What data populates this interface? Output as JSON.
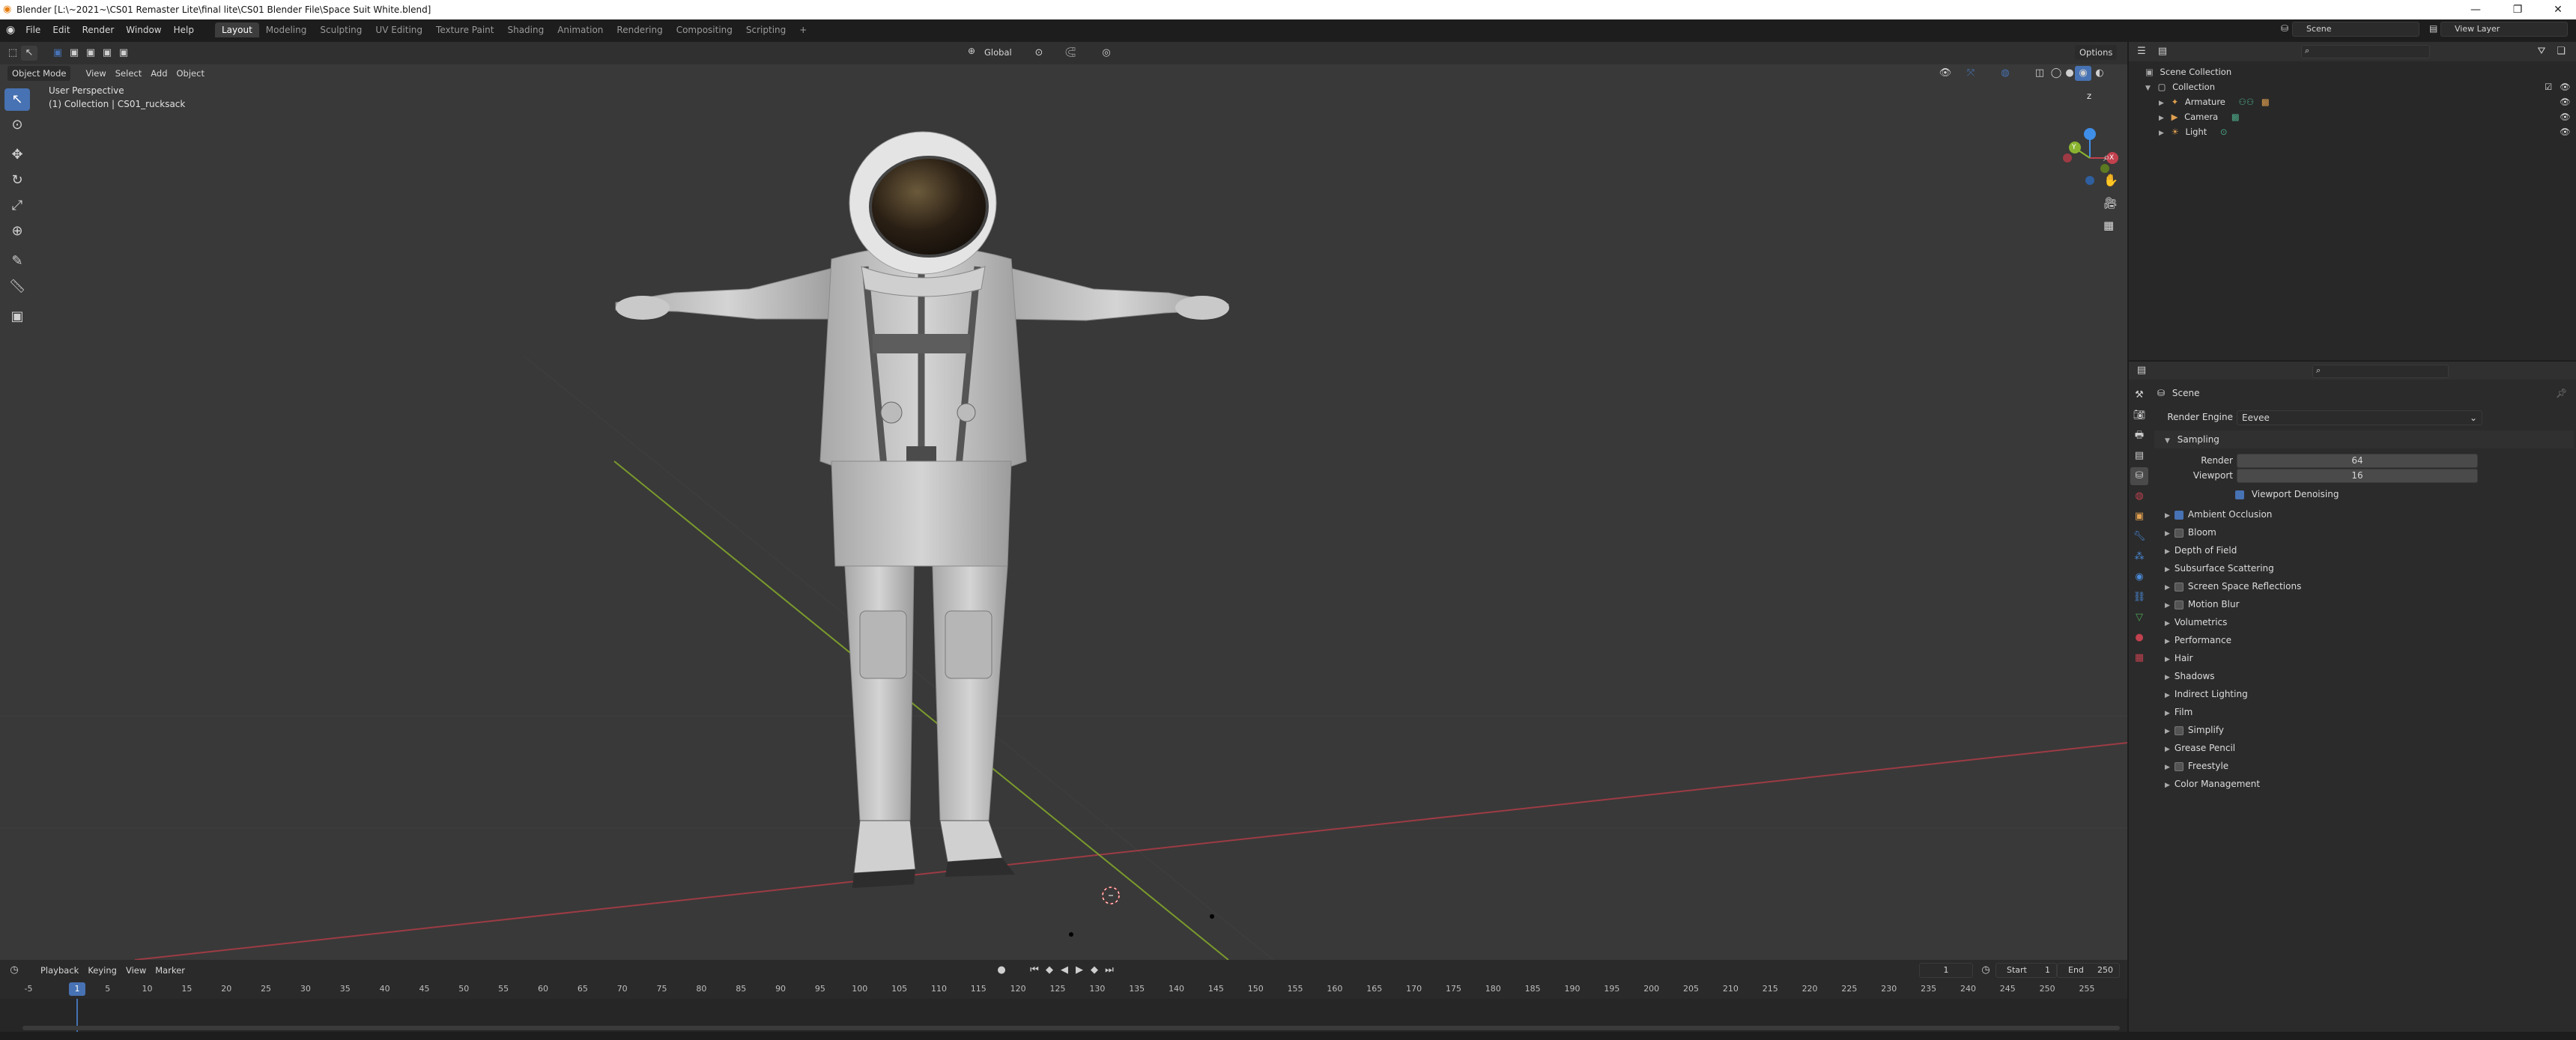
{
  "window": {
    "title": "Blender [L:\\~2021~\\CS01 Remaster Lite\\final lite\\CS01 Blender File\\Space Suit White.blend]",
    "minimize": "—",
    "maximize": "❐",
    "close": "✕"
  },
  "menubar": {
    "items": [
      "File",
      "Edit",
      "Render",
      "Window",
      "Help"
    ],
    "workspaces": [
      "Layout",
      "Modeling",
      "Sculpting",
      "UV Editing",
      "Texture Paint",
      "Shading",
      "Animation",
      "Rendering",
      "Compositing",
      "Scripting"
    ],
    "active_workspace": "Layout",
    "add_tab": "+",
    "scene": "Scene",
    "view_layer": "View Layer"
  },
  "viewport": {
    "mode": "Object Mode",
    "menus": [
      "View",
      "Select",
      "Add",
      "Object"
    ],
    "transform_orientation": "Global",
    "options": "Options",
    "perspective_label": "User Perspective",
    "collection_label": "(1) Collection | CS01_rucksack",
    "gizmo": {
      "x": "X",
      "y": "Y",
      "z": "Z"
    }
  },
  "tools": [
    "cursor",
    "select-box",
    "move",
    "rotate",
    "scale",
    "transform",
    "annotate",
    "measure",
    "add-cube"
  ],
  "timeline": {
    "menus": [
      "Playback",
      "Keying",
      "View",
      "Marker"
    ],
    "current_frame": "1",
    "start_label": "Start",
    "start": "1",
    "end_label": "End",
    "end": "250",
    "playhead_frame": "1",
    "ticks": [
      "-5",
      "1",
      "5",
      "10",
      "15",
      "20",
      "25",
      "30",
      "35",
      "40",
      "45",
      "50",
      "55",
      "60",
      "65",
      "70",
      "75",
      "80",
      "85",
      "90",
      "95",
      "100",
      "105",
      "110",
      "115",
      "120",
      "125",
      "130",
      "135",
      "140",
      "145",
      "150",
      "155",
      "160",
      "165",
      "170",
      "175",
      "180",
      "185",
      "190",
      "195",
      "200",
      "205",
      "210",
      "215",
      "220",
      "225",
      "230",
      "235",
      "240",
      "245",
      "250",
      "255"
    ]
  },
  "outliner": {
    "root": "Scene Collection",
    "collection": "Collection",
    "items": [
      "Armature",
      "Camera",
      "Light"
    ]
  },
  "properties": {
    "context": "Scene",
    "render_engine_label": "Render Engine",
    "render_engine": "Eevee",
    "sampling": {
      "title": "Sampling",
      "render_label": "Render",
      "render_value": "64",
      "viewport_label": "Viewport",
      "viewport_value": "16",
      "denoise_label": "Viewport Denoising"
    },
    "panels": [
      {
        "label": "Ambient Occlusion",
        "checkbox": "on"
      },
      {
        "label": "Bloom",
        "checkbox": "off"
      },
      {
        "label": "Depth of Field",
        "checkbox": "none"
      },
      {
        "label": "Subsurface Scattering",
        "checkbox": "none"
      },
      {
        "label": "Screen Space Reflections",
        "checkbox": "off"
      },
      {
        "label": "Motion Blur",
        "checkbox": "off"
      },
      {
        "label": "Volumetrics",
        "checkbox": "none"
      },
      {
        "label": "Performance",
        "checkbox": "none"
      },
      {
        "label": "Hair",
        "checkbox": "none"
      },
      {
        "label": "Shadows",
        "checkbox": "none"
      },
      {
        "label": "Indirect Lighting",
        "checkbox": "none"
      },
      {
        "label": "Film",
        "checkbox": "none"
      },
      {
        "label": "Simplify",
        "checkbox": "off"
      },
      {
        "label": "Grease Pencil",
        "checkbox": "none"
      },
      {
        "label": "Freestyle",
        "checkbox": "off"
      },
      {
        "label": "Color Management",
        "checkbox": "none"
      }
    ]
  },
  "colors": {
    "accent": "#4772b3",
    "x_axis": "#c2414e",
    "y_axis": "#8ab430",
    "z_axis": "#3f8ee8",
    "viewport_bg": "#393939"
  }
}
